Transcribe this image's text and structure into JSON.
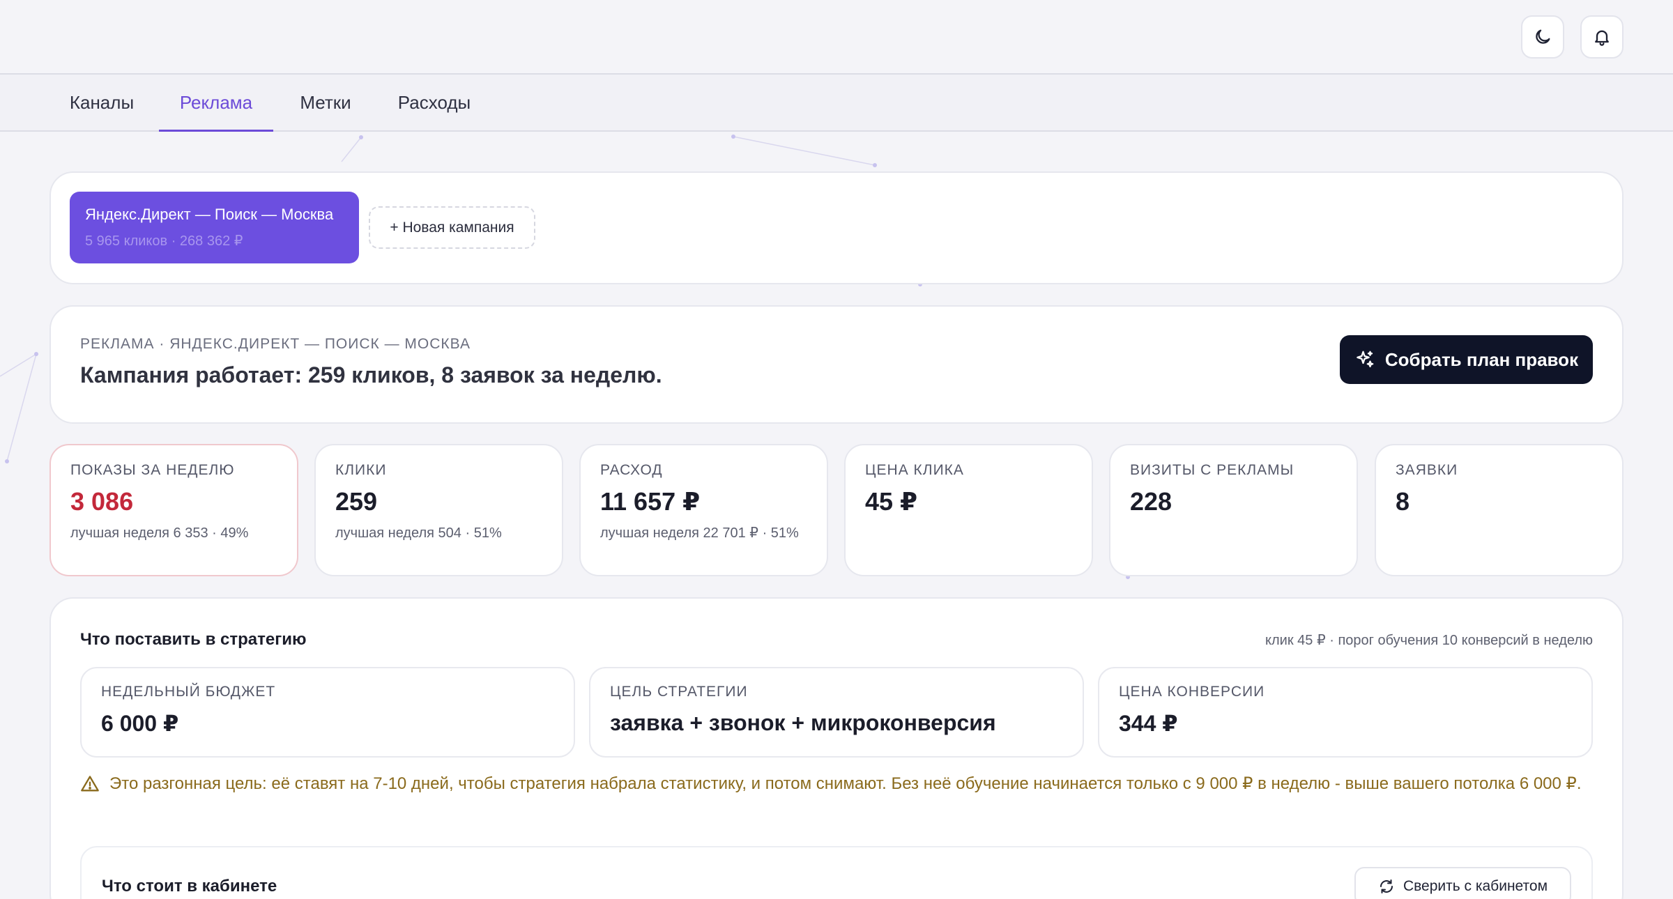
{
  "tabs": [
    "Каналы",
    "Реклама",
    "Метки",
    "Расходы"
  ],
  "active_tab": "Реклама",
  "icons": {
    "theme": "moon-icon",
    "notifications": "bell-icon",
    "plan": "sparkles-icon",
    "warning": "warning-triangle-icon",
    "sync": "refresh-icon"
  },
  "colors": {
    "accent": "#6c4bd8",
    "primary_button": "#0f1428",
    "alert_value": "#c3283a",
    "warning_text": "#8a6a1c"
  },
  "campaigns": {
    "selected": {
      "name": "Яндекс.Директ — Поиск — Москва",
      "stats": "5 965 кликов · 268 362 ₽"
    },
    "new_label": "+ Новая кампания"
  },
  "summary": {
    "overline": "РЕКЛАМА · ЯНДЕКС.ДИРЕКТ — ПОИСК — МОСКВА",
    "headline": "Кампания работает: 259 кликов, 8 заявок за неделю.",
    "plan_button": "Собрать план правок"
  },
  "metrics": [
    {
      "label": "ПОКАЗЫ ЗА НЕДЕЛЮ",
      "value": "3 086",
      "sub": "лучшая неделя 6 353 · 49%"
    },
    {
      "label": "КЛИКИ",
      "value": "259",
      "sub": "лучшая неделя 504 · 51%"
    },
    {
      "label": "РАСХОД",
      "value": "11 657 ₽",
      "sub": "лучшая неделя 22 701 ₽ · 51%"
    },
    {
      "label": "ЦЕНА КЛИКА",
      "value": "45 ₽",
      "sub": ""
    },
    {
      "label": "ВИЗИТЫ С РЕКЛАМЫ",
      "value": "228",
      "sub": ""
    },
    {
      "label": "ЗАЯВКИ",
      "value": "8",
      "sub": ""
    }
  ],
  "strategy": {
    "title": "Что поставить в стратегию",
    "meta": "клик 45 ₽ · порог обучения 10 конверсий в неделю",
    "boxes": [
      {
        "label": "НЕДЕЛЬНЫЙ БЮДЖЕТ",
        "value": "6 000 ₽"
      },
      {
        "label": "ЦЕЛЬ СТРАТЕГИИ",
        "value": "заявка + звонок + микроконверсия"
      },
      {
        "label": "ЦЕНА КОНВЕРСИИ",
        "value": "344 ₽"
      }
    ],
    "warning": "Это разгонная цель: её ставят на 7-10 дней, чтобы стратегия набрала статистику, и потом снимают. Без неё обучение начинается только с 9 000 ₽ в неделю - выше вашего потолка 6 000 ₽."
  },
  "cabinet": {
    "title": "Что стоит в кабинете",
    "sync_button": "Сверить с кабинетом"
  }
}
